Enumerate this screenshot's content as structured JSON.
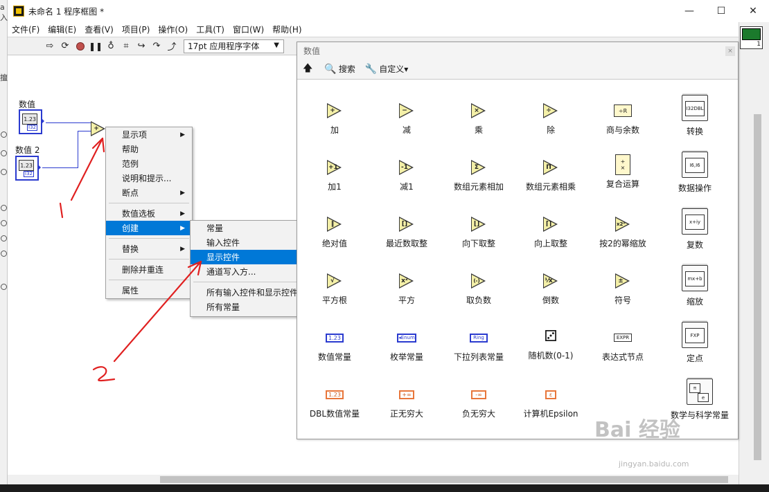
{
  "window": {
    "title": "未命名 1 程序框图 *",
    "minimize": "—",
    "maximize": "☐",
    "close": "✕"
  },
  "left_strip": {
    "top_label": "a入",
    "mid_label": "擅"
  },
  "menubar": [
    "文件(F)",
    "编辑(E)",
    "查看(V)",
    "项目(P)",
    "操作(O)",
    "工具(T)",
    "窗口(W)",
    "帮助(H)"
  ],
  "toolbar": {
    "font_select": "17pt 应用程序字体"
  },
  "connector": {
    "number": "1"
  },
  "canvas": {
    "node1_label": "数值",
    "node2_label": "数值 2",
    "ctl_value": "1.23",
    "ctl_type": "I32",
    "add_symbol": "+"
  },
  "context_menu": {
    "items": [
      "显示项",
      "帮助",
      "范例",
      "说明和提示...",
      "断点",
      "数值选板",
      "创建",
      "替换",
      "删除并重连",
      "属性"
    ],
    "submenu_arrow": "▶"
  },
  "submenu": {
    "items": [
      "常量",
      "输入控件",
      "显示控件",
      "通道写入方...",
      "所有输入控件和显示控件",
      "所有常量"
    ]
  },
  "palette": {
    "title": "数值",
    "close_label": "×",
    "search_label": "搜索",
    "customize_label": "自定义▾",
    "items": [
      "加",
      "减",
      "乘",
      "除",
      "商与余数",
      "转换",
      "加1",
      "减1",
      "数组元素相加",
      "数组元素相乘",
      "复合运算",
      "数据操作",
      "绝对值",
      "最近数取整",
      "向下取整",
      "向上取整",
      "按2的幂缩放",
      "复数",
      "平方根",
      "平方",
      "取负数",
      "倒数",
      "符号",
      "缩放",
      "数值常量",
      "枚举常量",
      "下拉列表常量",
      "随机数(0-1)",
      "表达式节点",
      "定点",
      "DBL数值常量",
      "正无穷大",
      "负无穷大",
      "计算机Epsilon",
      "数学与科学常量"
    ],
    "icon_glyphs": {
      "add": "+",
      "sub": "−",
      "mul": "×",
      "div": "÷",
      "inc": "+1",
      "dec": "-1",
      "sum": "Σ",
      "prod": "Π",
      "abs": "‖",
      "round": "[]",
      "floor": "⌊⌋",
      "ceil": "⌈⌉",
      "scale2": "x2ⁿ",
      "sqrt": "√",
      "square": "x²",
      "neg": "(-)",
      "recip": "⅟x",
      "sign": "±",
      "rand": "⚂",
      "inf_pos": "+∞",
      "inf_neg": "-∞",
      "eps": "ε",
      "num_const": "1.23",
      "enum_const": "◂Enum",
      "ring_const": "Ring",
      "expr": "EXPR",
      "qr": "÷R",
      "convert1": "I32",
      "convert2": "DBL",
      "complex": "x+iy",
      "scaling": "mx+b",
      "fxp": "FXP",
      "pi": "π",
      "e": "e",
      "dbl_const": "1.23",
      "data_ops": "I6,I6"
    }
  },
  "annotations": {
    "n1": "1",
    "n2": "2"
  },
  "watermark": {
    "brand": "Bai 经验",
    "url": "jingyan.baidu.com"
  }
}
